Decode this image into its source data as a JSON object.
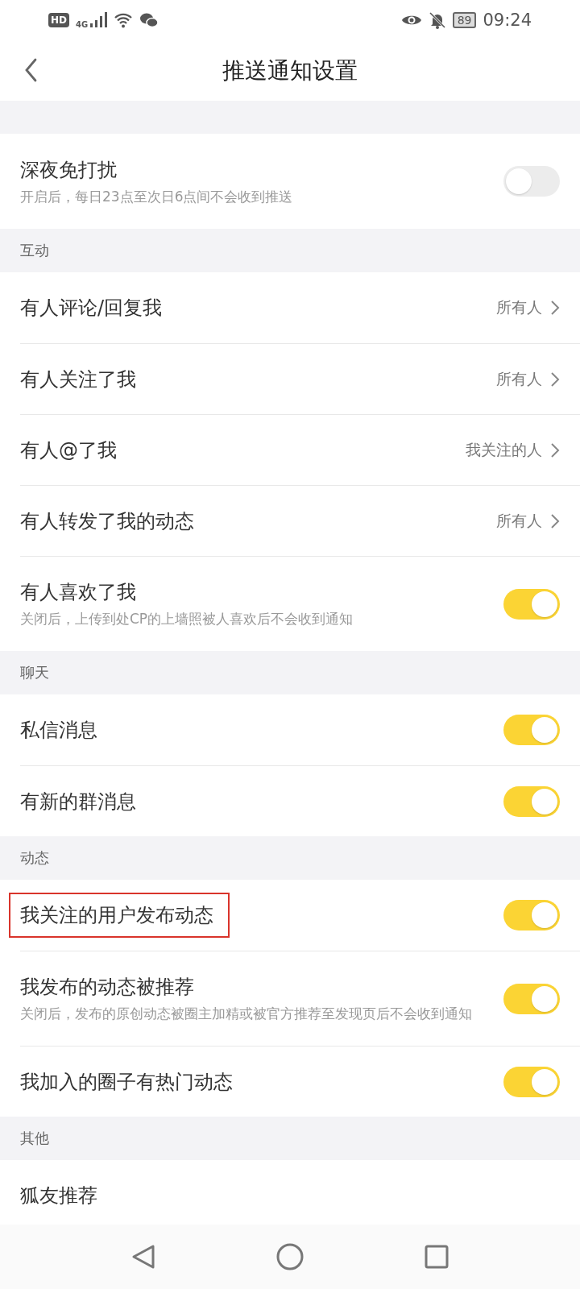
{
  "status_bar": {
    "hd": "HD",
    "network": "4G",
    "battery": "89",
    "time": "09:24"
  },
  "header": {
    "title": "推送通知设置"
  },
  "sections": [
    {
      "items": [
        {
          "kind": "toggle",
          "label": "深夜免打扰",
          "description": "开启后，每日23点至次日6点间不会收到推送",
          "on": false,
          "highlighted": false
        }
      ]
    },
    {
      "title": "互动",
      "items": [
        {
          "kind": "link",
          "label": "有人评论/回复我",
          "value": "所有人",
          "highlighted": false
        },
        {
          "kind": "link",
          "label": "有人关注了我",
          "value": "所有人",
          "highlighted": false
        },
        {
          "kind": "link",
          "label": "有人@了我",
          "value": "我关注的人",
          "highlighted": false
        },
        {
          "kind": "link",
          "label": "有人转发了我的动态",
          "value": "所有人",
          "highlighted": false
        },
        {
          "kind": "toggle",
          "label": "有人喜欢了我",
          "description": "关闭后，上传到处CP的上墙照被人喜欢后不会收到通知",
          "on": true,
          "highlighted": false
        }
      ]
    },
    {
      "title": "聊天",
      "items": [
        {
          "kind": "toggle",
          "label": "私信消息",
          "on": true,
          "highlighted": false
        },
        {
          "kind": "toggle",
          "label": "有新的群消息",
          "on": true,
          "highlighted": false
        }
      ]
    },
    {
      "title": "动态",
      "items": [
        {
          "kind": "toggle",
          "label": "我关注的用户发布动态",
          "on": true,
          "highlighted": true
        },
        {
          "kind": "toggle",
          "label": "我发布的动态被推荐",
          "description": "关闭后，发布的原创动态被圈主加精或被官方推荐至发现页后不会收到通知",
          "on": true,
          "highlighted": false
        },
        {
          "kind": "toggle",
          "label": "我加入的圈子有热门动态",
          "on": true,
          "highlighted": false
        }
      ]
    },
    {
      "title": "其他",
      "items": [
        {
          "kind": "link",
          "label": "狐友推荐",
          "highlighted": false
        }
      ]
    }
  ]
}
